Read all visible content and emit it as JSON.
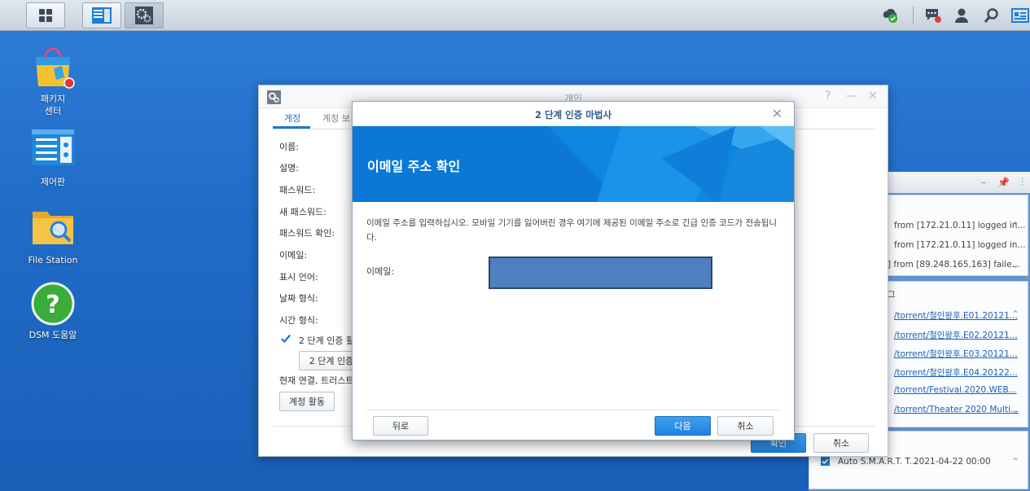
{
  "taskbar": {
    "buttons": [
      "main-menu",
      "control-panel",
      "personal-settings"
    ]
  },
  "desktop": {
    "icons": [
      {
        "label": "패키지\n센터",
        "line1": "패키지",
        "line2": "센터"
      },
      {
        "label": "제어판"
      },
      {
        "label": "File Station"
      },
      {
        "label": "DSM 도움말"
      }
    ]
  },
  "widgets": {
    "log_rows": [
      "from [172.21.0.11] logged in...",
      "from [172.21.0.11] logged in...",
      "] from [89.248.165.163] faile..."
    ],
    "section_title": "그",
    "file_rows": [
      "/torrent/철인왕후.E01.20121...",
      "/torrent/철인왕후.E02.20121...",
      "/torrent/철인왕후.E03.20121...",
      "/torrent/철인왕후.E04.20122...",
      "/torrent/Festival.2020.WEB...",
      "/torrent/Theater 2020 Multi..."
    ],
    "task": {
      "name": "Auto S.M.A.R.T. T...",
      "time": "2021-04-22 00:00"
    }
  },
  "personal_window": {
    "title": "개인",
    "tabs": [
      "계정",
      "계정 보"
    ],
    "labels": [
      "이름:",
      "설명:",
      "패스워드:",
      "새 패스워드:",
      "패스워드 확인:",
      "이메일:",
      "표시 언어:",
      "날짜 형식:",
      "시간 형식:"
    ],
    "two_step_checkbox_label": "2 단계 인증 활",
    "two_step_button": "2 단계 인증",
    "current_connection_label": "현재 연결, 트러스트",
    "account_activity_button": "계정 활동",
    "ok_button": "확인",
    "cancel_button": "취소"
  },
  "wizard": {
    "title": "2 단계 인증 마법사",
    "heading": "이메일 주소 확인",
    "description": "이메일 주소를 입력하십시오. 모바일 기기를 잃어버린 경우 여기에 제공된 이메일 주소로 긴급 인증 코드가 전송됩니다.",
    "email_label": "이메일:",
    "email_value": "",
    "back_button": "뒤로",
    "next_button": "다음",
    "cancel_button": "취소"
  },
  "colors": {
    "desktop": "#1f6cc7",
    "accent": "#1a76d2",
    "banner": "#0c7ad6"
  }
}
